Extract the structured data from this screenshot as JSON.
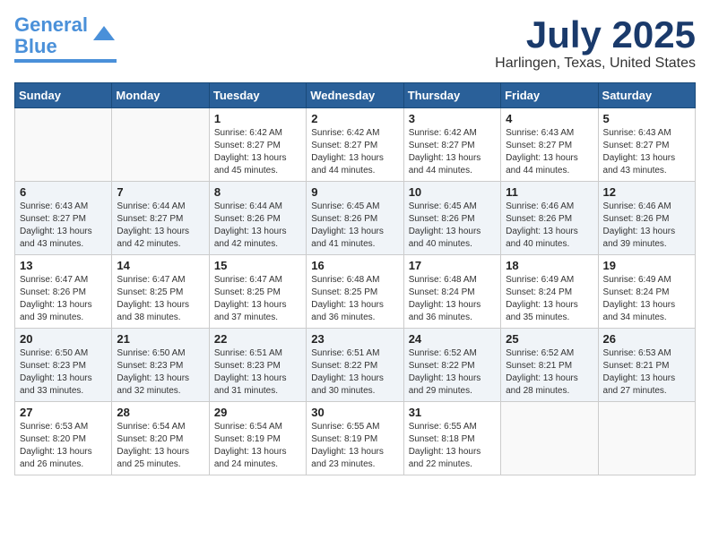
{
  "header": {
    "logo_line1": "General",
    "logo_line2": "Blue",
    "month": "July 2025",
    "location": "Harlingen, Texas, United States"
  },
  "weekdays": [
    "Sunday",
    "Monday",
    "Tuesday",
    "Wednesday",
    "Thursday",
    "Friday",
    "Saturday"
  ],
  "weeks": [
    [
      {
        "day": "",
        "sunrise": "",
        "sunset": "",
        "daylight": ""
      },
      {
        "day": "",
        "sunrise": "",
        "sunset": "",
        "daylight": ""
      },
      {
        "day": "1",
        "sunrise": "Sunrise: 6:42 AM",
        "sunset": "Sunset: 8:27 PM",
        "daylight": "Daylight: 13 hours and 45 minutes."
      },
      {
        "day": "2",
        "sunrise": "Sunrise: 6:42 AM",
        "sunset": "Sunset: 8:27 PM",
        "daylight": "Daylight: 13 hours and 44 minutes."
      },
      {
        "day": "3",
        "sunrise": "Sunrise: 6:42 AM",
        "sunset": "Sunset: 8:27 PM",
        "daylight": "Daylight: 13 hours and 44 minutes."
      },
      {
        "day": "4",
        "sunrise": "Sunrise: 6:43 AM",
        "sunset": "Sunset: 8:27 PM",
        "daylight": "Daylight: 13 hours and 44 minutes."
      },
      {
        "day": "5",
        "sunrise": "Sunrise: 6:43 AM",
        "sunset": "Sunset: 8:27 PM",
        "daylight": "Daylight: 13 hours and 43 minutes."
      }
    ],
    [
      {
        "day": "6",
        "sunrise": "Sunrise: 6:43 AM",
        "sunset": "Sunset: 8:27 PM",
        "daylight": "Daylight: 13 hours and 43 minutes."
      },
      {
        "day": "7",
        "sunrise": "Sunrise: 6:44 AM",
        "sunset": "Sunset: 8:27 PM",
        "daylight": "Daylight: 13 hours and 42 minutes."
      },
      {
        "day": "8",
        "sunrise": "Sunrise: 6:44 AM",
        "sunset": "Sunset: 8:26 PM",
        "daylight": "Daylight: 13 hours and 42 minutes."
      },
      {
        "day": "9",
        "sunrise": "Sunrise: 6:45 AM",
        "sunset": "Sunset: 8:26 PM",
        "daylight": "Daylight: 13 hours and 41 minutes."
      },
      {
        "day": "10",
        "sunrise": "Sunrise: 6:45 AM",
        "sunset": "Sunset: 8:26 PM",
        "daylight": "Daylight: 13 hours and 40 minutes."
      },
      {
        "day": "11",
        "sunrise": "Sunrise: 6:46 AM",
        "sunset": "Sunset: 8:26 PM",
        "daylight": "Daylight: 13 hours and 40 minutes."
      },
      {
        "day": "12",
        "sunrise": "Sunrise: 6:46 AM",
        "sunset": "Sunset: 8:26 PM",
        "daylight": "Daylight: 13 hours and 39 minutes."
      }
    ],
    [
      {
        "day": "13",
        "sunrise": "Sunrise: 6:47 AM",
        "sunset": "Sunset: 8:26 PM",
        "daylight": "Daylight: 13 hours and 39 minutes."
      },
      {
        "day": "14",
        "sunrise": "Sunrise: 6:47 AM",
        "sunset": "Sunset: 8:25 PM",
        "daylight": "Daylight: 13 hours and 38 minutes."
      },
      {
        "day": "15",
        "sunrise": "Sunrise: 6:47 AM",
        "sunset": "Sunset: 8:25 PM",
        "daylight": "Daylight: 13 hours and 37 minutes."
      },
      {
        "day": "16",
        "sunrise": "Sunrise: 6:48 AM",
        "sunset": "Sunset: 8:25 PM",
        "daylight": "Daylight: 13 hours and 36 minutes."
      },
      {
        "day": "17",
        "sunrise": "Sunrise: 6:48 AM",
        "sunset": "Sunset: 8:24 PM",
        "daylight": "Daylight: 13 hours and 36 minutes."
      },
      {
        "day": "18",
        "sunrise": "Sunrise: 6:49 AM",
        "sunset": "Sunset: 8:24 PM",
        "daylight": "Daylight: 13 hours and 35 minutes."
      },
      {
        "day": "19",
        "sunrise": "Sunrise: 6:49 AM",
        "sunset": "Sunset: 8:24 PM",
        "daylight": "Daylight: 13 hours and 34 minutes."
      }
    ],
    [
      {
        "day": "20",
        "sunrise": "Sunrise: 6:50 AM",
        "sunset": "Sunset: 8:23 PM",
        "daylight": "Daylight: 13 hours and 33 minutes."
      },
      {
        "day": "21",
        "sunrise": "Sunrise: 6:50 AM",
        "sunset": "Sunset: 8:23 PM",
        "daylight": "Daylight: 13 hours and 32 minutes."
      },
      {
        "day": "22",
        "sunrise": "Sunrise: 6:51 AM",
        "sunset": "Sunset: 8:23 PM",
        "daylight": "Daylight: 13 hours and 31 minutes."
      },
      {
        "day": "23",
        "sunrise": "Sunrise: 6:51 AM",
        "sunset": "Sunset: 8:22 PM",
        "daylight": "Daylight: 13 hours and 30 minutes."
      },
      {
        "day": "24",
        "sunrise": "Sunrise: 6:52 AM",
        "sunset": "Sunset: 8:22 PM",
        "daylight": "Daylight: 13 hours and 29 minutes."
      },
      {
        "day": "25",
        "sunrise": "Sunrise: 6:52 AM",
        "sunset": "Sunset: 8:21 PM",
        "daylight": "Daylight: 13 hours and 28 minutes."
      },
      {
        "day": "26",
        "sunrise": "Sunrise: 6:53 AM",
        "sunset": "Sunset: 8:21 PM",
        "daylight": "Daylight: 13 hours and 27 minutes."
      }
    ],
    [
      {
        "day": "27",
        "sunrise": "Sunrise: 6:53 AM",
        "sunset": "Sunset: 8:20 PM",
        "daylight": "Daylight: 13 hours and 26 minutes."
      },
      {
        "day": "28",
        "sunrise": "Sunrise: 6:54 AM",
        "sunset": "Sunset: 8:20 PM",
        "daylight": "Daylight: 13 hours and 25 minutes."
      },
      {
        "day": "29",
        "sunrise": "Sunrise: 6:54 AM",
        "sunset": "Sunset: 8:19 PM",
        "daylight": "Daylight: 13 hours and 24 minutes."
      },
      {
        "day": "30",
        "sunrise": "Sunrise: 6:55 AM",
        "sunset": "Sunset: 8:19 PM",
        "daylight": "Daylight: 13 hours and 23 minutes."
      },
      {
        "day": "31",
        "sunrise": "Sunrise: 6:55 AM",
        "sunset": "Sunset: 8:18 PM",
        "daylight": "Daylight: 13 hours and 22 minutes."
      },
      {
        "day": "",
        "sunrise": "",
        "sunset": "",
        "daylight": ""
      },
      {
        "day": "",
        "sunrise": "",
        "sunset": "",
        "daylight": ""
      }
    ]
  ]
}
